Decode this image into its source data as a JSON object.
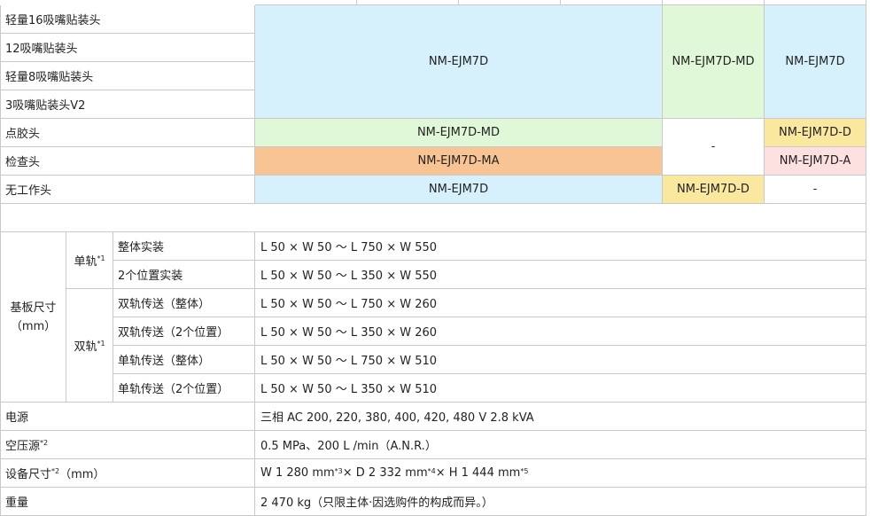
{
  "heads": {
    "r1": "轻量16吸嘴贴装头",
    "r2": "12吸嘴贴装头",
    "r3": "轻量8吸嘴贴装头",
    "r4": "3吸嘴贴装头V2",
    "dispense": "点胶头",
    "inspection": "检查头",
    "none": "无工作头",
    "v_main": "NM-EJM7D",
    "v_md_col": "NM-EJM7D-MD",
    "v_right": "NM-EJM7D",
    "dispense_main": "NM-EJM7D-MD",
    "dash_mid": "-",
    "dispense_right": "NM-EJM7D-D",
    "inspection_main": "NM-EJM7D-MA",
    "inspection_right": "NM-EJM7D-A",
    "none_main": "NM-EJM7D",
    "none_mid": "NM-EJM7D-D",
    "none_right": "-"
  },
  "board": {
    "label_line1": "基板尺寸",
    "label_line2": "（mm）",
    "single": {
      "label": "单轨",
      "note": "*1"
    },
    "dual": {
      "label": "双轨",
      "note": "*1"
    },
    "rows": [
      {
        "name": "整体实装",
        "value": "L 50 × W 50 ～ L 750 × W 550"
      },
      {
        "name": "2个位置实装",
        "value": "L 50 × W 50 ～ L 350 × W 550"
      },
      {
        "name": "双轨传送（整体）",
        "value": "L 50 × W 50 ～ L 750 × W 260"
      },
      {
        "name": "双轨传送（2个位置）",
        "value": "L 50 × W 50 ～ L 350 × W 260"
      },
      {
        "name": "单轨传送（整体）",
        "value": "L 50 × W 50 ～ L 750 × W 510"
      },
      {
        "name": "单轨传送（2个位置）",
        "value": "L 50 × W 50 ～ L 350 × W 510"
      }
    ]
  },
  "specs": {
    "power": {
      "label": "电源",
      "value": "三相 AC 200, 220, 380, 400, 420, 480 V 2.8 kVA"
    },
    "air": {
      "label": "空压源",
      "note": "*2",
      "value": "0.5 MPa、200 L /min（A.N.R.）"
    },
    "dims": {
      "label": "设备尺寸",
      "note": "*2",
      "unit": "（mm）",
      "w": "W 1 280 mm",
      "w_note": "*3",
      "d": " × D 2 332 mm",
      "d_note": "*4",
      "h": " × H 1 444 mm",
      "h_note": "*5"
    },
    "weight": {
      "label": "重量",
      "value": "2 470 kg（只限主体·因选购件的构成而异。）"
    }
  }
}
